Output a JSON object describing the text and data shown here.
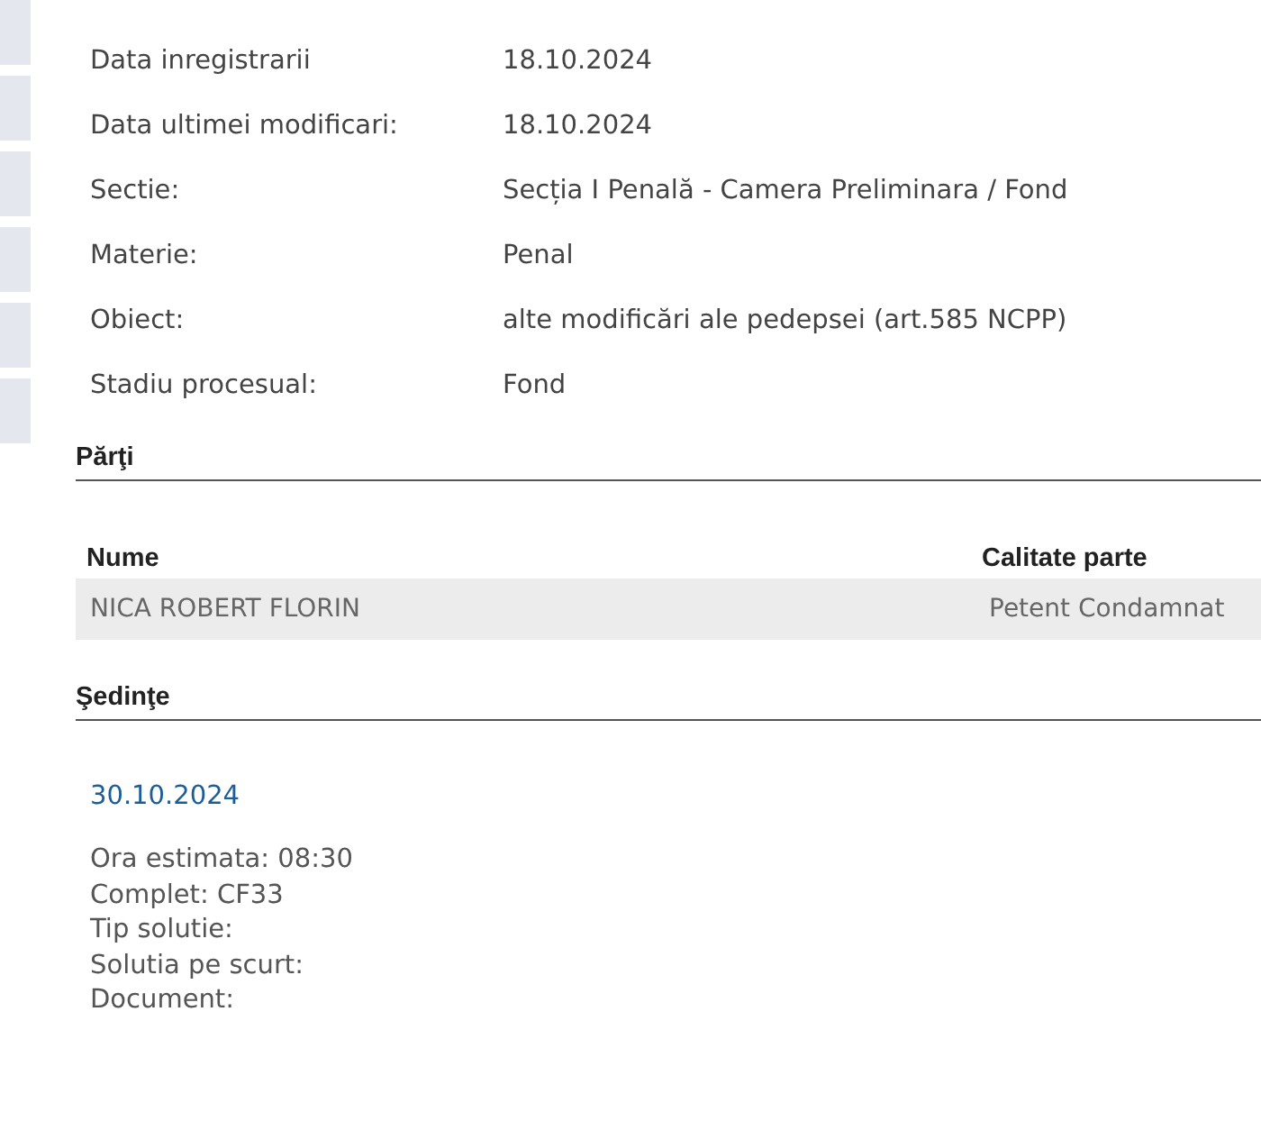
{
  "details": [
    {
      "label": "Data inregistrarii",
      "value": "18.10.2024"
    },
    {
      "label": "Data ultimei modificari:",
      "value": "18.10.2024"
    },
    {
      "label": "Sectie:",
      "value": "Secția I Penală - Camera Preliminara / Fond"
    },
    {
      "label": "Materie:",
      "value": "Penal"
    },
    {
      "label": "Obiect:",
      "value": "alte modificări ale pedepsei (art.585 NCPP)"
    },
    {
      "label": "Stadiu procesual:",
      "value": "Fond"
    }
  ],
  "parti": {
    "title": "Părţi",
    "columns": [
      "Nume",
      "Calitate parte"
    ],
    "rows": [
      [
        "NICA ROBERT FLORIN",
        "Petent Condamnat"
      ]
    ]
  },
  "sedinte": {
    "title": "Şedinţe",
    "date": "30.10.2024",
    "lines": [
      "Ora estimata: 08:30",
      "Complet: CF33",
      "Tip solutie:",
      "Solutia pe scurt:",
      "Document:"
    ]
  }
}
